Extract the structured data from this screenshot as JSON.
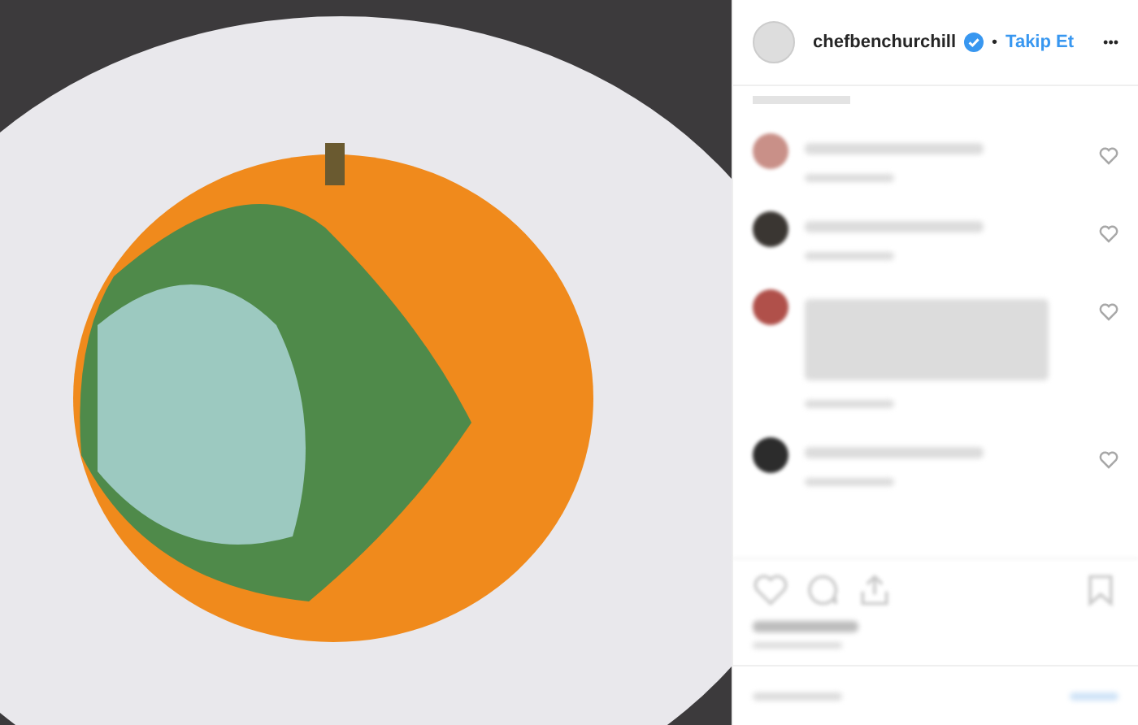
{
  "post": {
    "author": {
      "username": "chefbenchurchill",
      "verified": true,
      "separator": "•",
      "follow": "Takip Et",
      "more": "•••"
    },
    "comments": [
      {
        "color": "#c99088",
        "kind": "short"
      },
      {
        "color": "#3a3632",
        "kind": "short"
      },
      {
        "color": "#b0504a",
        "kind": "long"
      },
      {
        "color": "#2c2c2c",
        "kind": "short"
      }
    ]
  }
}
